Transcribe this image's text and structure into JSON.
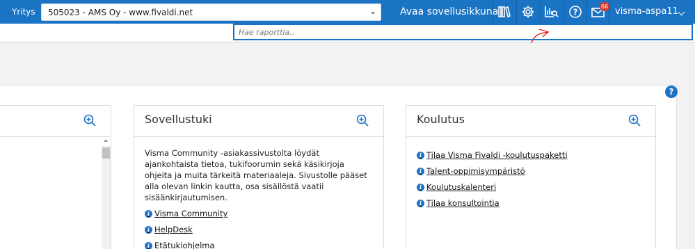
{
  "topbar": {
    "company_label": "Yritys",
    "company_value": "505023 - AMS Oy - www.fivaldi.net",
    "open_app_label": "Avaa sovellusikkuna",
    "icons": [
      "library-icon",
      "gear-icon",
      "report-search-icon",
      "help-icon",
      "mail-icon"
    ],
    "mail_badge": "66",
    "user_name": "visma-aspa11"
  },
  "search": {
    "placeholder": "Hae raporttia.."
  },
  "help_badge": "?",
  "panels": {
    "sovellustuki": {
      "title": "Sovellustuki",
      "description": "Visma Community -asiakassivustolta löydät ajankohtaista tietoa, tukifoorumin sekä käsikirjoja ohjeita ja muita tärkeitä materiaaleja. Sivustolle pääset alla olevan linkin kautta, osa sisällöstä vaatii sisäänkirjautumisen.",
      "links": [
        " Visma Community",
        " HelpDesk",
        " Etätukiohjelma"
      ]
    },
    "koulutus": {
      "title": "Koulutus",
      "links": [
        " Tilaa Visma Fivaldi -koulutuspaketti",
        " Talent-oppimisympäristö",
        " Koulutuskalenteri",
        " Tilaa konsultointia"
      ]
    }
  },
  "colors": {
    "brand": "#1b73c4",
    "annotation": "#e02020",
    "badge": "#d93a2b"
  }
}
